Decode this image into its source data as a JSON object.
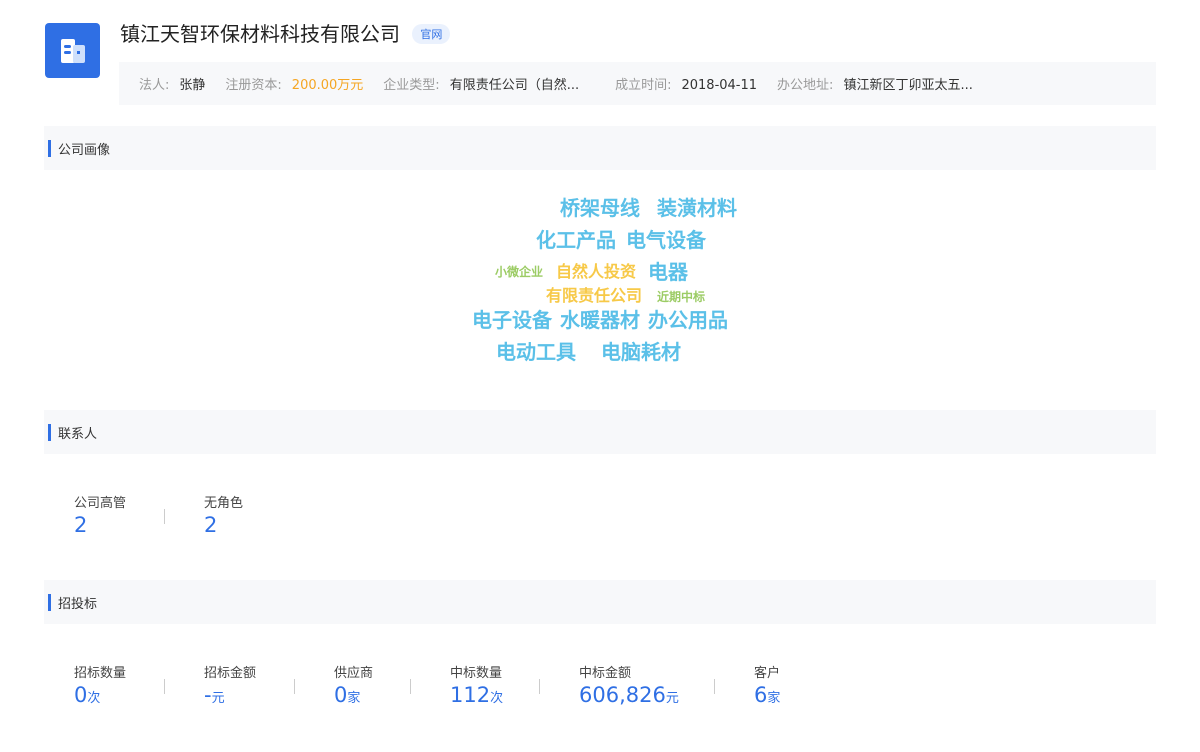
{
  "company": {
    "name": "镇江天智环保材料科技有限公司",
    "badge": "官网"
  },
  "info": {
    "legal_label": "法人:",
    "legal": "张静",
    "capital_label": "注册资本:",
    "capital": "200.00万元",
    "type_label": "企业类型:",
    "type": "有限责任公司（自然...",
    "date_label": "成立时间:",
    "date": "2018-04-11",
    "addr_label": "办公地址:",
    "addr": "镇江新区丁卯亚太五..."
  },
  "sections": {
    "profile": "公司画像",
    "contacts": "联系人",
    "bidding": "招投标"
  },
  "cloud_words": [
    {
      "text": "桥架母线",
      "color": "#5bc0e8"
    },
    {
      "text": "装潢材料",
      "color": "#5bc0e8"
    },
    {
      "text": "化工产品",
      "color": "#5bc0e8"
    },
    {
      "text": "电气设备",
      "color": "#5bc0e8"
    },
    {
      "text": "小微企业",
      "color": "#9ccc65"
    },
    {
      "text": "自然人投资",
      "color": "#f7c948"
    },
    {
      "text": "电器",
      "color": "#5bc0e8"
    },
    {
      "text": "有限责任公司",
      "color": "#f7c948"
    },
    {
      "text": "近期中标",
      "color": "#9ccc65"
    },
    {
      "text": "电子设备",
      "color": "#5bc0e8"
    },
    {
      "text": "水暖器材",
      "color": "#5bc0e8"
    },
    {
      "text": "办公用品",
      "color": "#5bc0e8"
    },
    {
      "text": "电动工具",
      "color": "#5bc0e8"
    },
    {
      "text": "电脑耗材",
      "color": "#5bc0e8"
    }
  ],
  "contacts": [
    {
      "label": "公司高管",
      "value": "2"
    },
    {
      "label": "无角色",
      "value": "2"
    }
  ],
  "bidding": [
    {
      "label": "招标数量",
      "value": "0",
      "unit": "次"
    },
    {
      "label": "招标金额",
      "value": "-",
      "unit": "元"
    },
    {
      "label": "供应商",
      "value": "0",
      "unit": "家"
    },
    {
      "label": "中标数量",
      "value": "112",
      "unit": "次"
    },
    {
      "label": "中标金额",
      "value": "606,826",
      "unit": "元"
    },
    {
      "label": "客户",
      "value": "6",
      "unit": "家"
    }
  ]
}
